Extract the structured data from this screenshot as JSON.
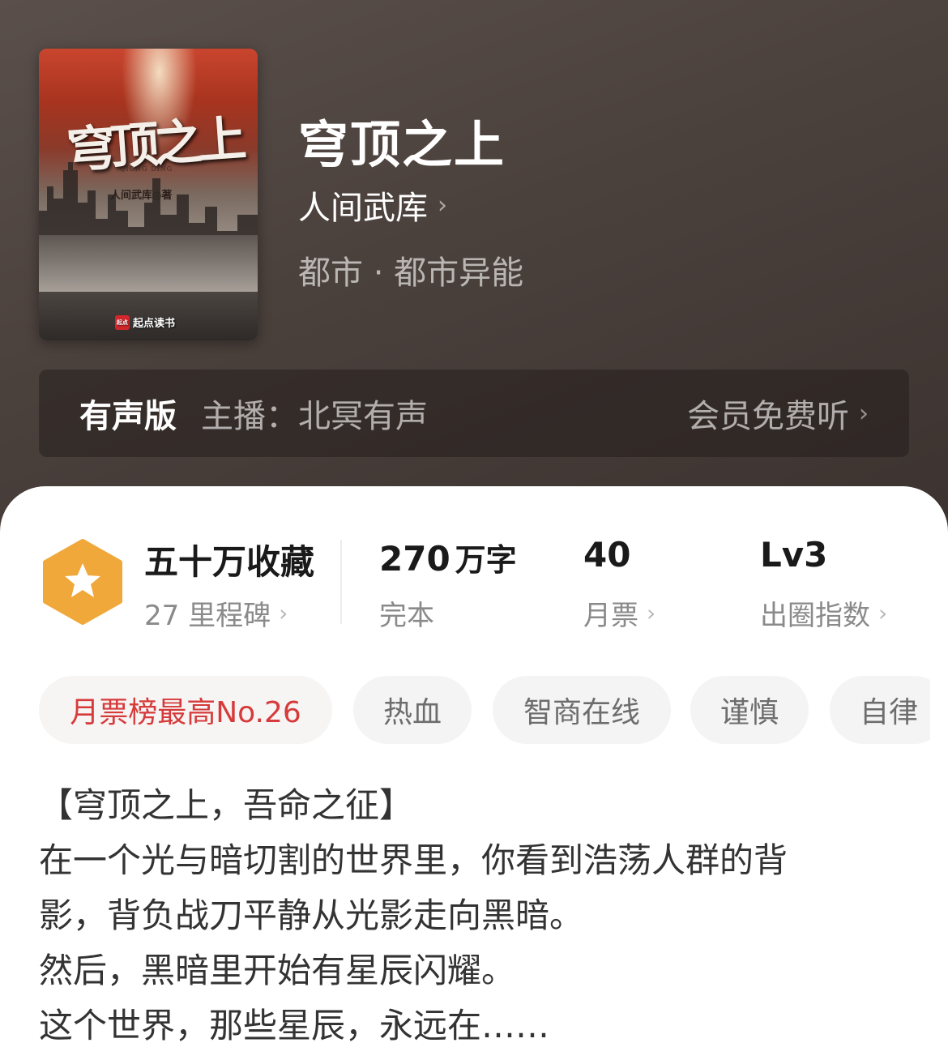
{
  "book": {
    "title": "穹顶之上",
    "author": "人间武库",
    "genre": "都市 · 都市异能"
  },
  "cover": {
    "title_art": "穹顶之上",
    "subtitle_art": "QIONG DING",
    "author_art": "人间武库◎著",
    "publisher_art": "起点读书",
    "publisher_logo": "起点"
  },
  "audio": {
    "label": "有声版",
    "host": "主播：北冥有声",
    "free_label": "会员免费听"
  },
  "stats": {
    "collection": {
      "title": "五十万收藏",
      "sub": "27 里程碑"
    },
    "words": {
      "value": "270",
      "unit": "万字",
      "sub": "完本"
    },
    "monthly": {
      "value": "40",
      "sub": "月票"
    },
    "influence": {
      "value": "Lv3",
      "sub": "出圈指数"
    }
  },
  "tags": [
    "月票榜最高No.26",
    "热血",
    "智商在线",
    "谨慎",
    "自律"
  ],
  "description": [
    "【穹顶之上，吾命之征】",
    "在一个光与暗切割的世界里，你看到浩荡人群的背",
    "影，背负战刀平静从光影走向黑暗。",
    "然后，黑暗里开始有星辰闪耀。",
    "这个世界，那些星辰，永远在……"
  ],
  "colors": {
    "hero_bg": "#4a403c",
    "badge_orange": "#f0a83a",
    "tag_highlight": "#d63a3a"
  }
}
